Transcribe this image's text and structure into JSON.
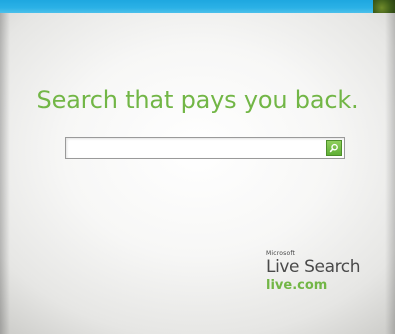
{
  "banner": {
    "tagline": "Search that pays you back."
  },
  "search": {
    "value": "",
    "placeholder": "",
    "button_icon": "search-icon"
  },
  "brand": {
    "microsoft": "Microsoft",
    "product": "Live Search",
    "url": "live.com"
  },
  "colors": {
    "accent_green": "#72b646",
    "top_strip_blue": "#1ea7e0"
  }
}
